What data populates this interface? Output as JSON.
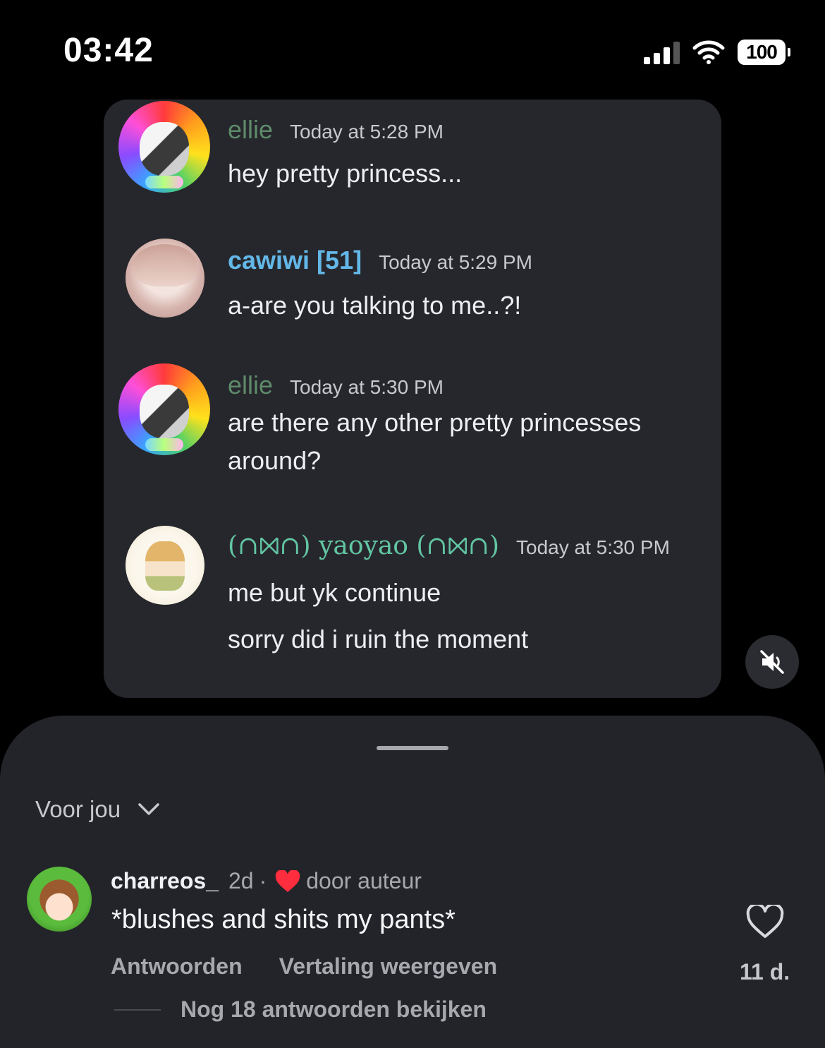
{
  "status_bar": {
    "time": "03:42",
    "battery": "100"
  },
  "chat": {
    "messages": [
      {
        "user": "ellie",
        "user_color": "#5e8a6a",
        "time": "Today at 5:28 PM",
        "lines": [
          "hey pretty princess..."
        ]
      },
      {
        "user": "cawiwi [51]",
        "user_color": "#63b8e8",
        "time": "Today at 5:29 PM",
        "lines": [
          "a-are you talking to me..?!"
        ]
      },
      {
        "user": "ellie",
        "user_color": "#5e8a6a",
        "time": "Today at 5:30 PM",
        "lines": [
          "are there any other pretty princesses",
          "around?"
        ]
      },
      {
        "user": "(∩⨝∩) yaoyao (∩⨝∩)",
        "user_color": "#62c6a3",
        "time": "Today at 5:30 PM",
        "lines": [
          "me but yk continue",
          "sorry did i ruin the moment"
        ]
      }
    ]
  },
  "video": {
    "mute_icon": "muted-speaker-icon"
  },
  "comments": {
    "filter_label": "Voor jou",
    "items": [
      {
        "user": "charreos_",
        "age": "2d",
        "separator": "·",
        "liked_by_author": "door auteur",
        "text": "*blushes and shits my pants*",
        "reply_label": "Antwoorden",
        "translate_label": "Vertaling weergeven",
        "like_count": "11 d.",
        "more_replies": "Nog 18 antwoorden bekijken"
      }
    ]
  },
  "colors": {
    "background": "#000000",
    "chat_card": "#26272c",
    "sheet": "#232429",
    "author_heart": "#ff2d3d"
  }
}
